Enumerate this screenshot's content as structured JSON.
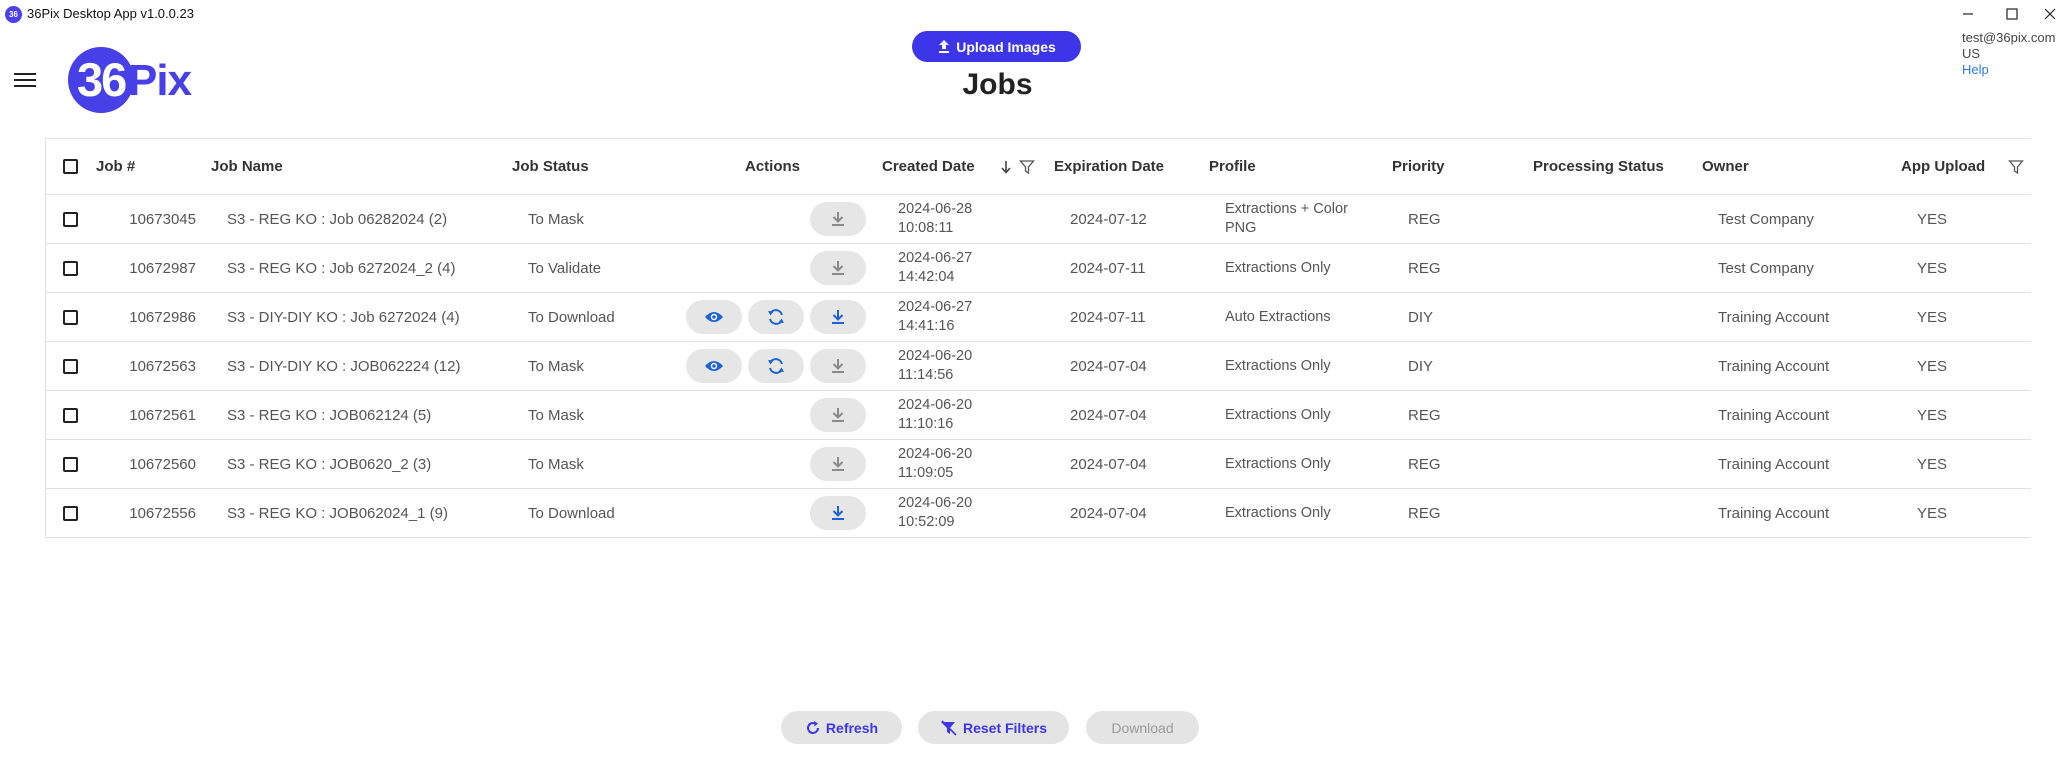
{
  "window": {
    "icon_text": "36",
    "title": "36Pix Desktop App v1.0.0.23"
  },
  "header": {
    "logo_num": "36",
    "logo_text": "Pix",
    "upload_label": "Upload Images",
    "page_title": "Jobs",
    "user_email": "test@36pix.com",
    "user_region": "US",
    "help_label": "Help"
  },
  "table": {
    "columns": {
      "job_num": "Job #",
      "job_name": "Job Name",
      "job_status": "Job Status",
      "actions": "Actions",
      "created": "Created Date",
      "expiration": "Expiration Date",
      "profile": "Profile",
      "priority": "Priority",
      "processing": "Processing Status",
      "owner": "Owner",
      "app_upload": "App Upload"
    },
    "rows": [
      {
        "job_num": "10673045",
        "job_name": "S3 - REG KO : Job 06282024 (2)",
        "status": "To Mask",
        "created": "2024-06-28 10:08:11",
        "expiration": "2024-07-12",
        "profile": "Extractions + Color PNG",
        "priority": "REG",
        "processing": "",
        "owner": "Test Company",
        "app_upload": "YES"
      },
      {
        "job_num": "10672987",
        "job_name": "S3 - REG KO : Job 6272024_2 (4)",
        "status": "To Validate",
        "created": "2024-06-27 14:42:04",
        "expiration": "2024-07-11",
        "profile": "Extractions Only",
        "priority": "REG",
        "processing": "",
        "owner": "Test Company",
        "app_upload": "YES"
      },
      {
        "job_num": "10672986",
        "job_name": "S3 - DIY-DIY KO : Job 6272024 (4)",
        "status": "To Download",
        "created": "2024-06-27 14:41:16",
        "expiration": "2024-07-11",
        "profile": "Auto Extractions",
        "priority": "DIY",
        "processing": "",
        "owner": "Training Account",
        "app_upload": "YES"
      },
      {
        "job_num": "10672563",
        "job_name": "S3 - DIY-DIY KO : JOB062224 (12)",
        "status": "To Mask",
        "created": "2024-06-20 11:14:56",
        "expiration": "2024-07-04",
        "profile": "Extractions Only",
        "priority": "DIY",
        "processing": "",
        "owner": "Training Account",
        "app_upload": "YES"
      },
      {
        "job_num": "10672561",
        "job_name": "S3 - REG KO : JOB062124 (5)",
        "status": "To Mask",
        "created": "2024-06-20 11:10:16",
        "expiration": "2024-07-04",
        "profile": "Extractions Only",
        "priority": "REG",
        "processing": "",
        "owner": "Training Account",
        "app_upload": "YES"
      },
      {
        "job_num": "10672560",
        "job_name": "S3 - REG KO : JOB0620_2 (3)",
        "status": "To Mask",
        "created": "2024-06-20 11:09:05",
        "expiration": "2024-07-04",
        "profile": "Extractions Only",
        "priority": "REG",
        "processing": "",
        "owner": "Training Account",
        "app_upload": "YES"
      },
      {
        "job_num": "10672556",
        "job_name": "S3 - REG KO : JOB062024_1 (9)",
        "status": "To Download",
        "created": "2024-06-20 10:52:09",
        "expiration": "2024-07-04",
        "profile": "Extractions Only",
        "priority": "REG",
        "processing": "",
        "owner": "Training Account",
        "app_upload": "YES"
      }
    ]
  },
  "footer": {
    "refresh_label": "Refresh",
    "reset_label": "Reset Filters",
    "download_label": "Download"
  },
  "icons": {
    "download": "download-icon",
    "view": "eye-icon",
    "reprocess": "sync-icon",
    "filter": "filter-icon",
    "sort": "arrow-down-icon"
  },
  "colors": {
    "brand": "#3d36e8",
    "active_icon": "#1e63d6",
    "disabled_icon": "#8a8a8a",
    "button_bg": "#e6e6e6"
  }
}
